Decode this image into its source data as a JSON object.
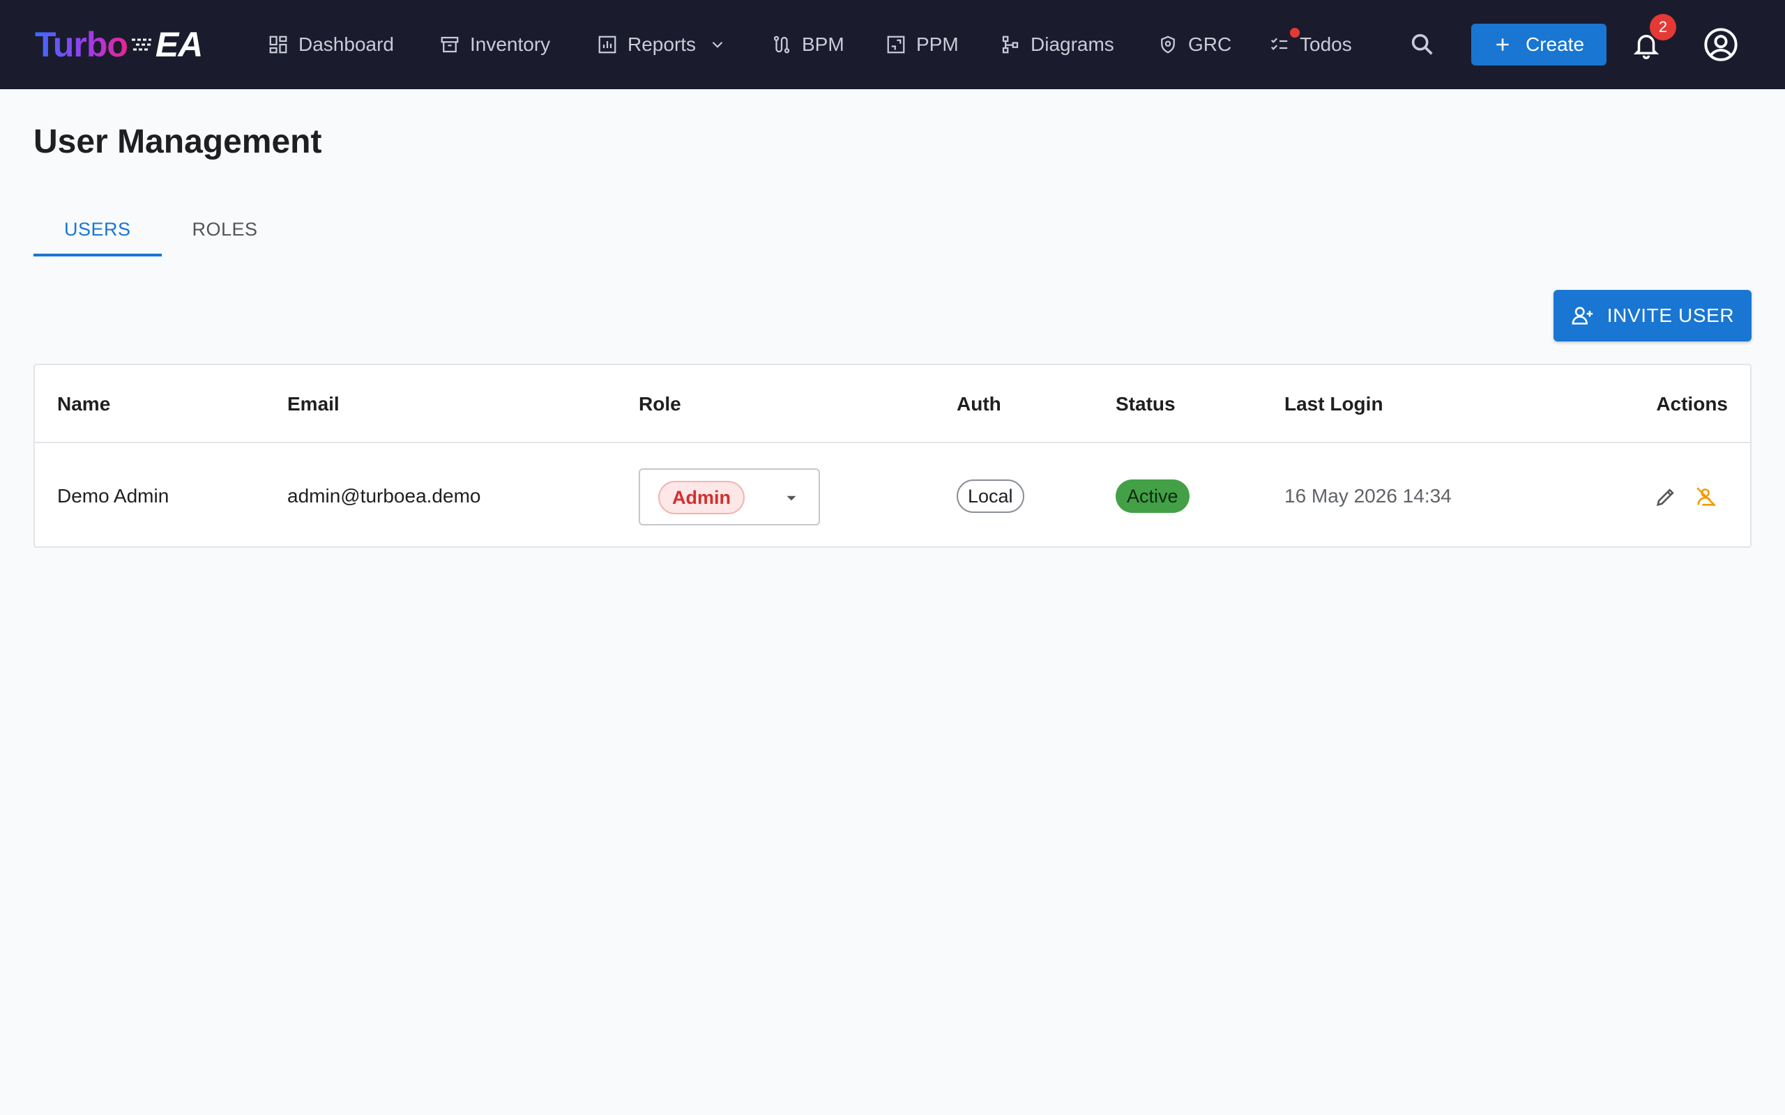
{
  "app": {
    "logo_part1": "Turbo",
    "logo_part2": "EA"
  },
  "nav": {
    "items": [
      {
        "label": "Dashboard",
        "icon": "dashboard-icon"
      },
      {
        "label": "Inventory",
        "icon": "archive-icon"
      },
      {
        "label": "Reports",
        "icon": "bar-chart-icon",
        "has_dropdown": true
      },
      {
        "label": "BPM",
        "icon": "route-icon"
      },
      {
        "label": "PPM",
        "icon": "project-icon"
      },
      {
        "label": "Diagrams",
        "icon": "hierarchy-icon"
      },
      {
        "label": "GRC",
        "icon": "shield-icon"
      },
      {
        "label": "Todos",
        "icon": "checklist-icon",
        "has_dot": true
      }
    ],
    "create_label": "Create",
    "notification_count": "2",
    "colors": {
      "bar": "#1a1c2e",
      "accent": "#1976d2",
      "badge": "#e53935"
    }
  },
  "page": {
    "title": "User Management",
    "tabs": [
      {
        "label": "USERS",
        "active": true
      },
      {
        "label": "ROLES",
        "active": false
      }
    ],
    "invite_label": "INVITE USER"
  },
  "table": {
    "headers": {
      "name": "Name",
      "email": "Email",
      "role": "Role",
      "auth": "Auth",
      "status": "Status",
      "last_login": "Last Login",
      "actions": "Actions"
    },
    "rows": [
      {
        "name": "Demo Admin",
        "email": "admin@turboea.demo",
        "role": "Admin",
        "auth": "Local",
        "status": "Active",
        "last_login": "16 May 2026 14:34",
        "actions": [
          "edit-icon",
          "deactivate-user-icon"
        ]
      }
    ]
  }
}
